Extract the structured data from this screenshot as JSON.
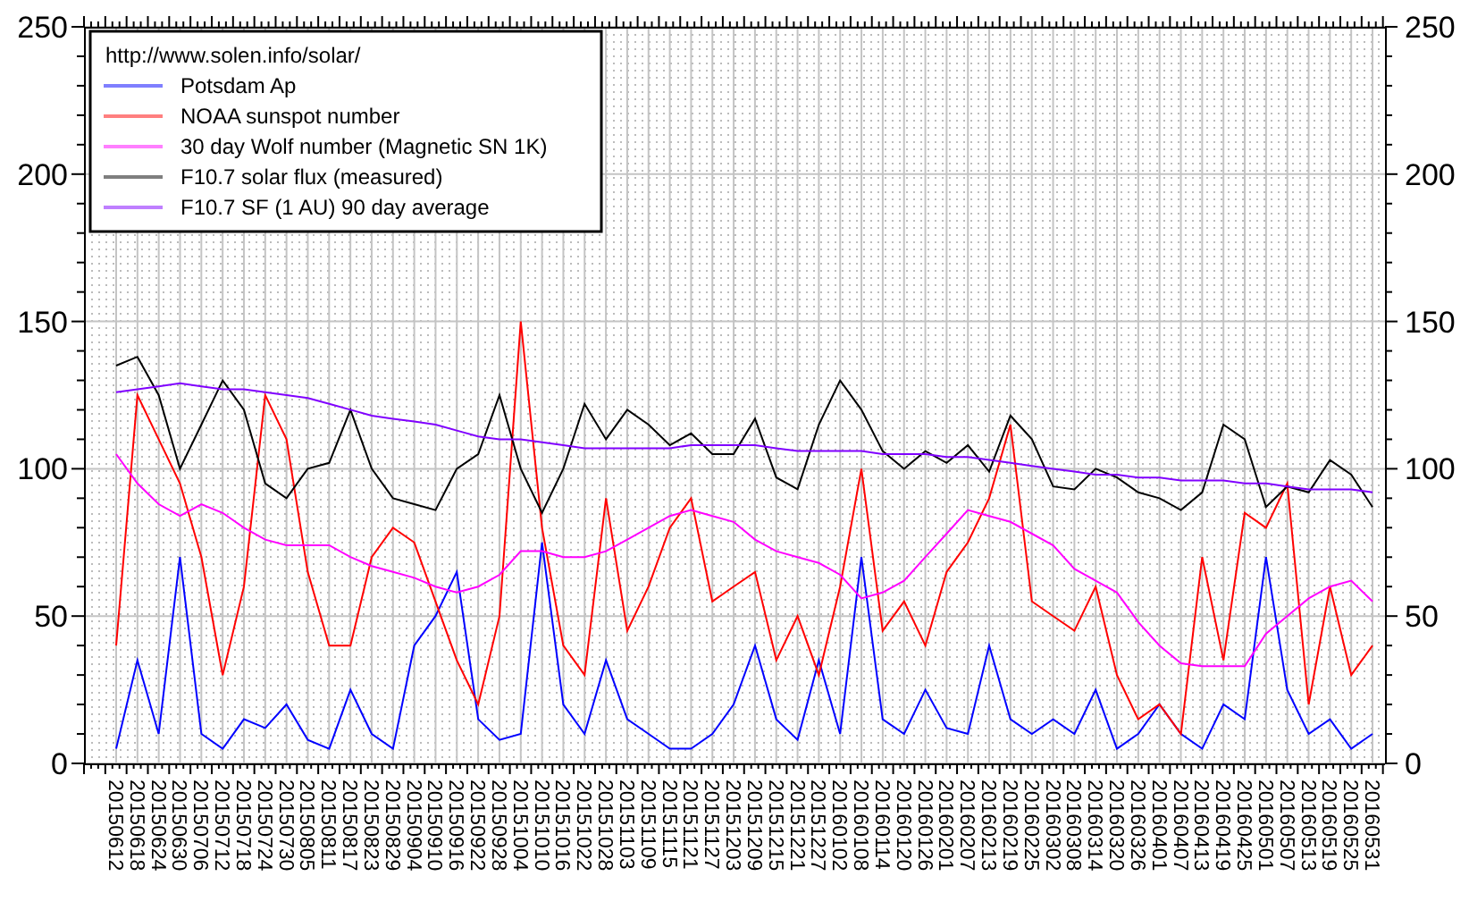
{
  "chart_data": {
    "type": "line",
    "categories": [
      "20150612",
      "20150618",
      "20150624",
      "20150630",
      "20150706",
      "20150712",
      "20150718",
      "20150724",
      "20150730",
      "20150805",
      "20150811",
      "20150817",
      "20150823",
      "20150829",
      "20150904",
      "20150910",
      "20150916",
      "20150922",
      "20150928",
      "20151004",
      "20151010",
      "20151016",
      "20151022",
      "20151028",
      "20151103",
      "20151109",
      "20151115",
      "20151121",
      "20151127",
      "20151203",
      "20151209",
      "20151215",
      "20151221",
      "20151227",
      "20160102",
      "20160108",
      "20160114",
      "20160120",
      "20160126",
      "20160201",
      "20160207",
      "20160213",
      "20160219",
      "20160225",
      "20160302",
      "20160308",
      "20160314",
      "20160320",
      "20160326",
      "20160401",
      "20160407",
      "20160413",
      "20160419",
      "20160425",
      "20160501",
      "20160507",
      "20160513",
      "20160519",
      "20160525",
      "20160531"
    ],
    "series": [
      {
        "name": "Potsdam Ap",
        "color": "#0000ff",
        "values": [
          5,
          35,
          10,
          70,
          10,
          5,
          15,
          12,
          20,
          8,
          5,
          25,
          10,
          5,
          40,
          50,
          65,
          15,
          8,
          10,
          75,
          20,
          10,
          35,
          15,
          10,
          5,
          5,
          10,
          20,
          40,
          15,
          8,
          35,
          10,
          70,
          15,
          10,
          25,
          12,
          10,
          40,
          15,
          10,
          15,
          10,
          25,
          5,
          10,
          20,
          10,
          5,
          20,
          15,
          70,
          25,
          10,
          15,
          5,
          10
        ]
      },
      {
        "name": "NOAA sunspot number",
        "color": "#ff0000",
        "values": [
          40,
          125,
          110,
          95,
          70,
          30,
          60,
          125,
          110,
          65,
          40,
          40,
          70,
          80,
          75,
          55,
          35,
          20,
          50,
          150,
          80,
          40,
          30,
          90,
          45,
          60,
          80,
          90,
          55,
          60,
          65,
          35,
          50,
          30,
          60,
          100,
          45,
          55,
          40,
          65,
          75,
          90,
          115,
          55,
          50,
          45,
          60,
          30,
          15,
          20,
          10,
          70,
          35,
          85,
          80,
          95,
          20,
          60,
          30,
          40
        ]
      },
      {
        "name": "30 day Wolf number (Magnetic SN 1K)",
        "color": "#ff00ff",
        "values": [
          105,
          95,
          88,
          84,
          88,
          85,
          80,
          76,
          74,
          74,
          74,
          70,
          67,
          65,
          63,
          60,
          58,
          60,
          64,
          72,
          72,
          70,
          70,
          72,
          76,
          80,
          84,
          86,
          84,
          82,
          76,
          72,
          70,
          68,
          64,
          56,
          58,
          62,
          70,
          78,
          86,
          84,
          82,
          78,
          74,
          66,
          62,
          58,
          48,
          40,
          34,
          33,
          33,
          33,
          44,
          50,
          56,
          60,
          62,
          55
        ]
      },
      {
        "name": "F10.7 solar flux (measured)",
        "color": "#000000",
        "values": [
          135,
          138,
          125,
          100,
          115,
          130,
          120,
          95,
          90,
          100,
          102,
          120,
          100,
          90,
          88,
          86,
          100,
          105,
          125,
          100,
          85,
          100,
          122,
          110,
          120,
          115,
          108,
          112,
          105,
          105,
          117,
          97,
          93,
          115,
          130,
          120,
          106,
          100,
          106,
          102,
          108,
          99,
          118,
          110,
          94,
          93,
          100,
          97,
          92,
          90,
          86,
          92,
          115,
          110,
          87,
          94,
          92,
          103,
          98,
          87
        ]
      },
      {
        "name": "F10.7 SF (1 AU) 90 day average",
        "color": "#8000ff",
        "values": [
          126,
          127,
          128,
          129,
          128,
          127,
          127,
          126,
          125,
          124,
          122,
          120,
          118,
          117,
          116,
          115,
          113,
          111,
          110,
          110,
          109,
          108,
          107,
          107,
          107,
          107,
          107,
          108,
          108,
          108,
          108,
          107,
          106,
          106,
          106,
          106,
          105,
          105,
          105,
          104,
          104,
          103,
          102,
          101,
          100,
          99,
          98,
          98,
          97,
          97,
          96,
          96,
          96,
          95,
          95,
          94,
          93,
          93,
          93,
          92
        ]
      }
    ],
    "ylim": [
      0,
      250
    ],
    "yticks": [
      0,
      50,
      100,
      150,
      200,
      250
    ],
    "y2ticks": [
      0,
      50,
      100,
      150,
      200,
      250
    ],
    "y2lim": [
      0,
      250
    ],
    "grid": true,
    "legend": true,
    "annotations": [
      "http://www.solen.info/solar/"
    ]
  }
}
